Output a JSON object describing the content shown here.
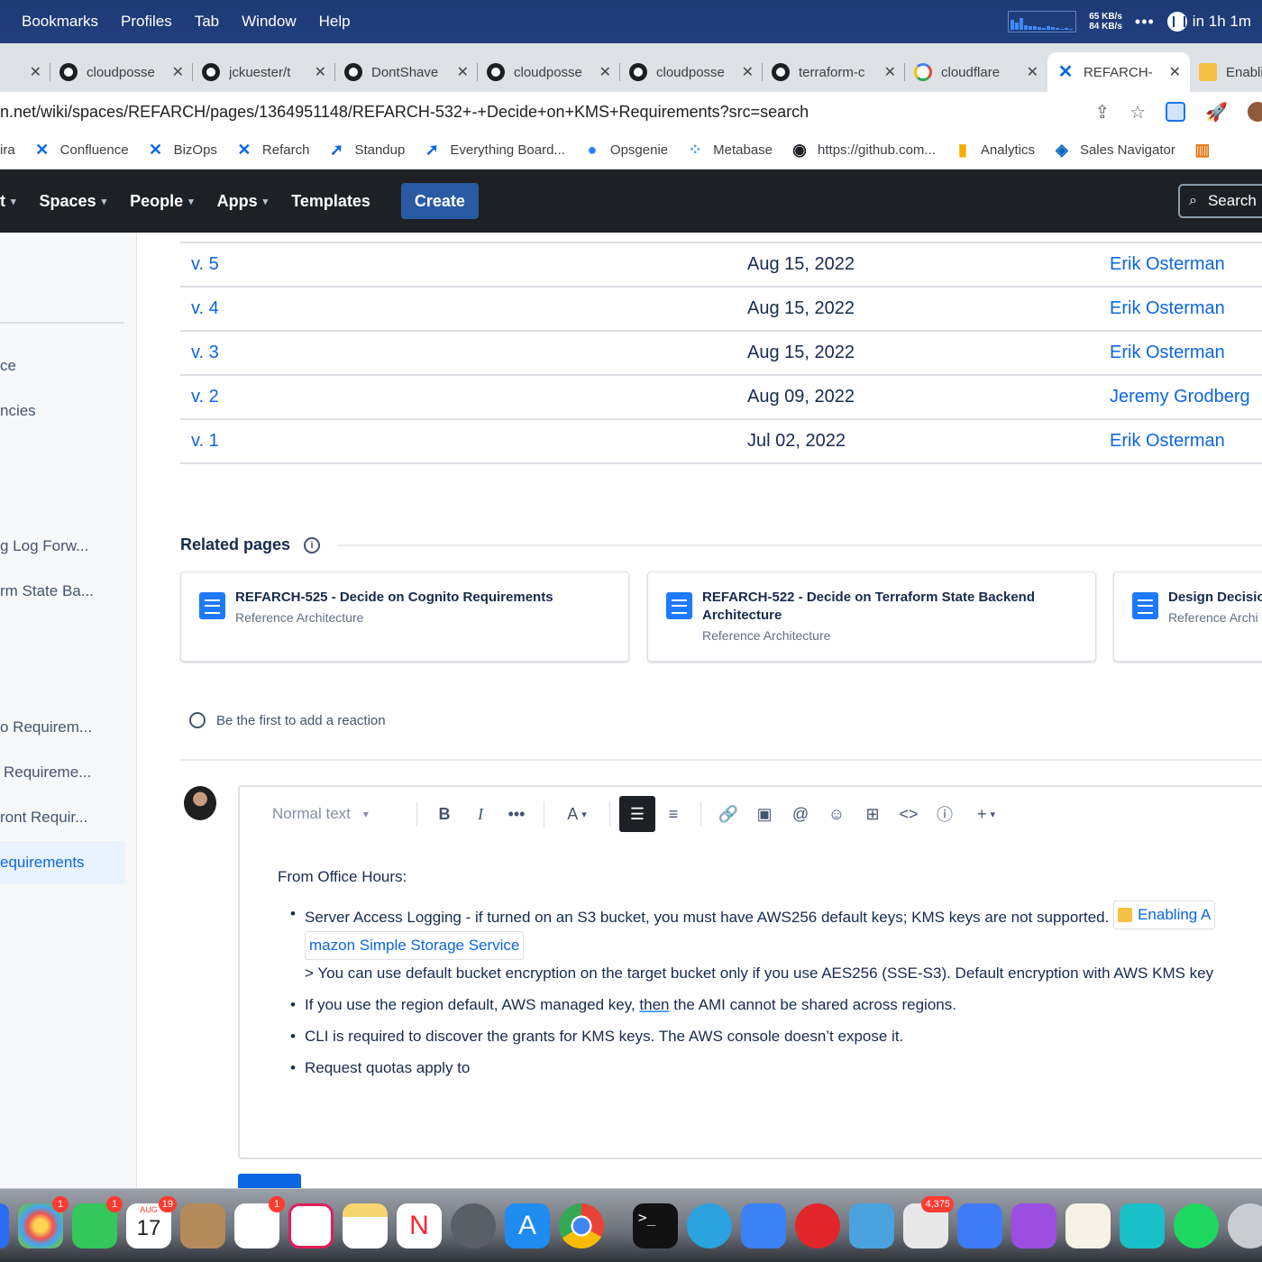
{
  "menubar": {
    "items": [
      "Bookmarks",
      "Profiles",
      "Tab",
      "Window",
      "Help"
    ],
    "net_up": "65 KB/s",
    "net_down": "84 KB/s",
    "timer": "in 1h 1m"
  },
  "tabs": [
    {
      "label": "",
      "icon": "tab-icon"
    },
    {
      "label": "cloudposse",
      "icon": "github-icon"
    },
    {
      "label": "jckuester/t",
      "icon": "github-icon"
    },
    {
      "label": "DontShave",
      "icon": "github-icon"
    },
    {
      "label": "cloudposse",
      "icon": "github-icon"
    },
    {
      "label": "cloudposse",
      "icon": "github-icon"
    },
    {
      "label": "terraform-c",
      "icon": "github-icon"
    },
    {
      "label": "cloudflare",
      "icon": "google-icon"
    },
    {
      "label": "REFARCH-",
      "icon": "confluence-icon",
      "active": true
    },
    {
      "label": "Enabli",
      "icon": "aws-box-icon"
    }
  ],
  "address": {
    "url": "n.net/wiki/spaces/REFARCH/pages/1364951148/REFARCH-532+-+Decide+on+KMS+Requirements?src=search"
  },
  "bookmarks": [
    "ira",
    "Confluence",
    "BizOps",
    "Refarch",
    "Standup",
    "Everything Board...",
    "Opsgenie",
    "Metabase",
    "https://github.com...",
    "Analytics",
    "Sales Navigator"
  ],
  "confluence_nav": {
    "items": [
      "t",
      "Spaces",
      "People",
      "Apps",
      "Templates"
    ],
    "create": "Create",
    "search": "Search"
  },
  "sidebar": {
    "items": [
      "ce",
      "ncies",
      "g Log Forw...",
      "rm State Ba...",
      "o Requirem...",
      "Requireme...",
      "ront Requir...",
      "equirements"
    ]
  },
  "versions": [
    {
      "version": "v. 5",
      "date": "Aug 15, 2022",
      "author": "Erik Osterman"
    },
    {
      "version": "v. 4",
      "date": "Aug 15, 2022",
      "author": "Erik Osterman"
    },
    {
      "version": "v. 3",
      "date": "Aug 15, 2022",
      "author": "Erik Osterman"
    },
    {
      "version": "v. 2",
      "date": "Aug 09, 2022",
      "author": "Jeremy Grodberg"
    },
    {
      "version": "v. 1",
      "date": "Jul 02, 2022",
      "author": "Erik Osterman"
    }
  ],
  "related": {
    "title": "Related pages",
    "cards": [
      {
        "title": "REFARCH-525 - Decide on Cognito Requirements",
        "space": "Reference Architecture"
      },
      {
        "title": "REFARCH-522 - Decide on Terraform State Backend Architecture",
        "space": "Reference Architecture"
      },
      {
        "title": "Design Decisio",
        "space": "Reference Archi"
      }
    ]
  },
  "reaction": "Be the first to add a reaction",
  "editor": {
    "style": "Normal text",
    "heading": "From Office Hours:",
    "bullets": {
      "b1_text": "Server Access Logging - if turned on an S3 bucket, you must have AWS256 default keys; KMS keys are not supported.",
      "b1_chip_a": "Enabling A",
      "b1_chip_b": "mazon Simple Storage Service",
      "b1_quote": "> You can use default bucket encryption on the target bucket only if you use AES256 (SSE-S3). Default encryption with AWS KMS key",
      "b2_pre": "If you use the region default, AWS managed key,",
      "b2_under": "then",
      "b2_post": "the AMI cannot be shared across regions.",
      "b3": "CLI is required to discover the grants for KMS keys. The AWS console doesn’t expose it.",
      "b4": "Request quotas apply to"
    }
  },
  "dock": {
    "photos_badge": "1",
    "facetime_badge": "1",
    "calendar_month": "AUG",
    "calendar_day": "17",
    "calendar_badge": "19",
    "reminders_badge": "1",
    "app_badge": "4,375"
  }
}
